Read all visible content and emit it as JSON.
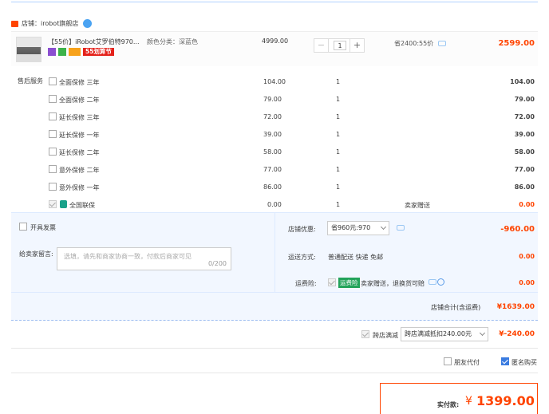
{
  "store": {
    "label": "店铺：irobot旗舰店"
  },
  "product": {
    "title": "【55价】iRobot艾罗伯特970...",
    "spec": "颜色分类：深蓝色",
    "orig_price": "4999.00",
    "qty": "1",
    "minus": "−",
    "plus": "+",
    "saving": "省2400:55价",
    "badge_55": "55划算节",
    "price": "2599.00"
  },
  "services_label": "售后服务",
  "services": [
    {
      "name": "全面保修 三年",
      "price": "104.00",
      "qty": "1",
      "total": "104.00"
    },
    {
      "name": "全面保修 二年",
      "price": "79.00",
      "qty": "1",
      "total": "79.00"
    },
    {
      "name": "延长保修 三年",
      "price": "72.00",
      "qty": "1",
      "total": "72.00"
    },
    {
      "name": "延长保修 一年",
      "price": "39.00",
      "qty": "1",
      "total": "39.00"
    },
    {
      "name": "延长保修 二年",
      "price": "58.00",
      "qty": "1",
      "total": "58.00"
    },
    {
      "name": "意外保修 二年",
      "price": "77.00",
      "qty": "1",
      "total": "77.00"
    },
    {
      "name": "意外保修 一年",
      "price": "86.00",
      "qty": "1",
      "total": "86.00"
    }
  ],
  "national": {
    "name": "全国联保",
    "price": "0.00",
    "qty": "1",
    "note": "卖家赠送",
    "total": "0.00"
  },
  "invoice": {
    "label": "开具发票"
  },
  "message": {
    "label": "给卖家留言:",
    "placeholder": "选填，请先和商家协商一致，付款后商家可见",
    "count": "0/200"
  },
  "discount": {
    "label": "店铺优惠:",
    "value": "省960元:970",
    "amount": "-960.00"
  },
  "shipping": {
    "label": "运送方式:",
    "value": "普通配送 快递 免邮",
    "amount": "0.00"
  },
  "insurance": {
    "label": "运费险:",
    "badge": "运费险",
    "value": "卖家赠送，退换货可赔",
    "amount": "0.00"
  },
  "store_total": {
    "label": "店铺合计(含运费)",
    "amount": "¥1639.00"
  },
  "cross": {
    "label": "跨店满减",
    "value": "跨店满减抵扣240.00元",
    "amount": "¥-240.00"
  },
  "options": {
    "friend_pay": "朋友代付",
    "anonymous": "匿名购买"
  },
  "final": {
    "label": "实付款:",
    "currency": "¥",
    "amount": "1399.00"
  },
  "colors": {
    "accent": "#ff4400",
    "blue": "#3a7be0",
    "panel": "#f2f7ff"
  }
}
